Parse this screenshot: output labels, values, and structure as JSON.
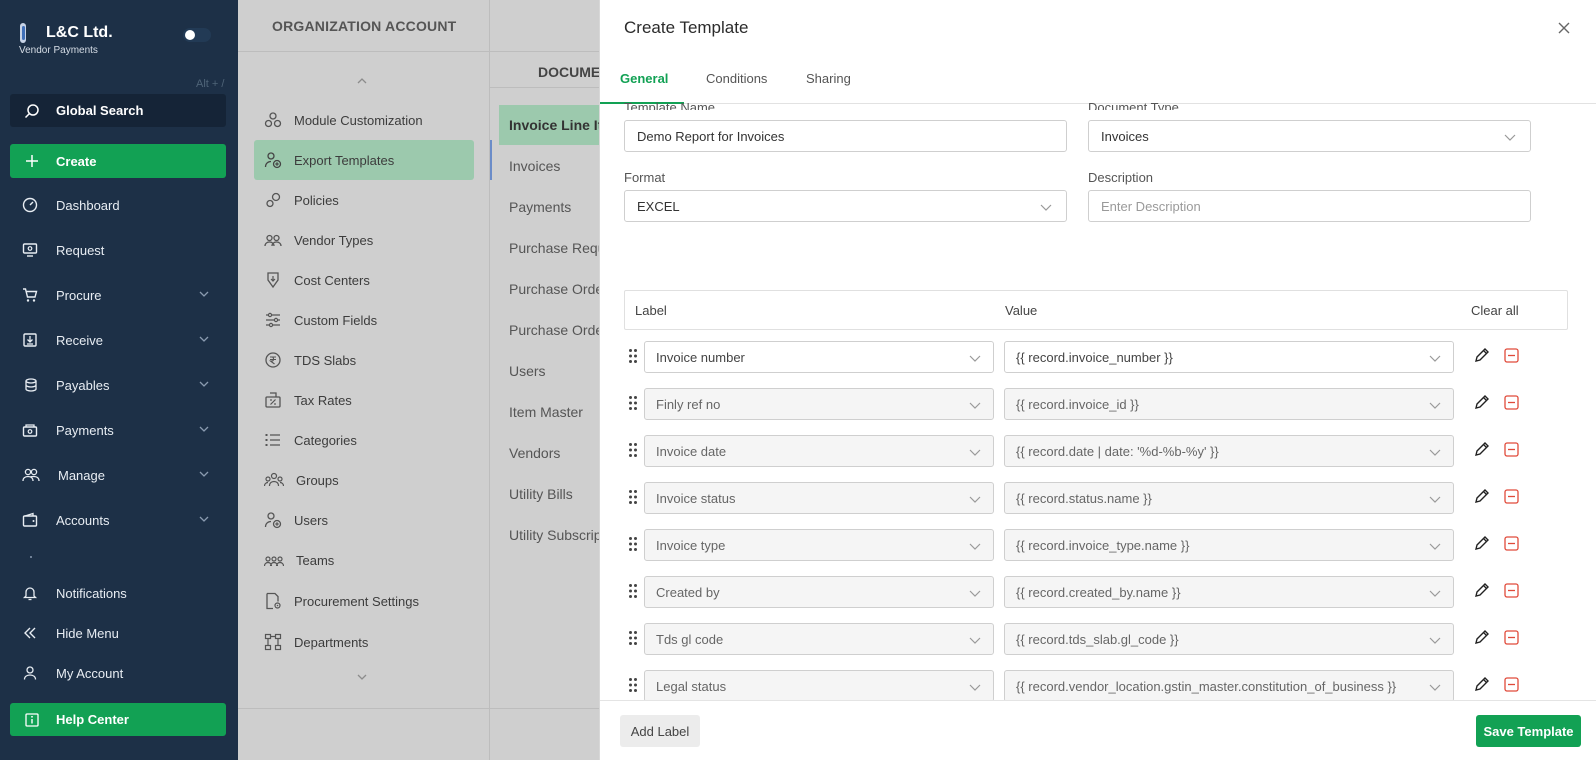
{
  "sidebar": {
    "brand_name": "L&C Ltd.",
    "brand_sub": "Vendor Payments",
    "shortcut_hint": "Alt + /",
    "search_label": "Global Search",
    "create_label": "Create",
    "items": [
      {
        "label": "Dashboard",
        "icon": "dashboard-icon",
        "expandable": false
      },
      {
        "label": "Request",
        "icon": "request-icon",
        "expandable": false
      },
      {
        "label": "Procure",
        "icon": "cart-icon",
        "expandable": true
      },
      {
        "label": "Receive",
        "icon": "receive-icon",
        "expandable": true
      },
      {
        "label": "Payables",
        "icon": "coins-icon",
        "expandable": true
      },
      {
        "label": "Payments",
        "icon": "payments-icon",
        "expandable": true
      },
      {
        "label": "Manage",
        "icon": "people-icon",
        "expandable": true
      },
      {
        "label": "Accounts",
        "icon": "wallet-icon",
        "expandable": true
      }
    ],
    "bottom_items": [
      {
        "label": "Notifications",
        "icon": "bell-icon"
      },
      {
        "label": "Hide Menu",
        "icon": "double-chevron-left-icon"
      },
      {
        "label": "My Account",
        "icon": "user-icon"
      }
    ],
    "help_label": "Help Center"
  },
  "settings": {
    "header": "ORGANIZATION ACCOUNT",
    "items": [
      {
        "label": "Module Customization",
        "icon": "modules-icon",
        "active": false
      },
      {
        "label": "Export Templates",
        "icon": "user-export-icon",
        "active": true
      },
      {
        "label": "Policies",
        "icon": "gears-icon",
        "active": false
      },
      {
        "label": "Vendor Types",
        "icon": "vendors-icon",
        "active": false
      },
      {
        "label": "Cost Centers",
        "icon": "cost-center-icon",
        "active": false
      },
      {
        "label": "Custom Fields",
        "icon": "sliders-icon",
        "active": false
      },
      {
        "label": "TDS Slabs",
        "icon": "tds-icon",
        "active": false
      },
      {
        "label": "Tax Rates",
        "icon": "tax-icon",
        "active": false
      },
      {
        "label": "Categories",
        "icon": "list-icon",
        "active": false
      },
      {
        "label": "Groups",
        "icon": "groups-icon",
        "active": false
      },
      {
        "label": "Users",
        "icon": "users-icon",
        "active": false
      },
      {
        "label": "Teams",
        "icon": "teams-icon",
        "active": false
      },
      {
        "label": "Procurement Settings",
        "icon": "procurement-settings-icon",
        "active": false
      },
      {
        "label": "Departments",
        "icon": "departments-icon",
        "active": false
      }
    ]
  },
  "documents": {
    "title": "DOCUMENTS",
    "items": [
      {
        "label": "Invoice Line Items",
        "active": true
      },
      {
        "label": "Invoices",
        "active": false
      },
      {
        "label": "Payments",
        "active": false
      },
      {
        "label": "Purchase Requests",
        "active": false
      },
      {
        "label": "Purchase Orders",
        "active": false
      },
      {
        "label": "Purchase Orders",
        "active": false
      },
      {
        "label": "Users",
        "active": false
      },
      {
        "label": "Item Master",
        "active": false
      },
      {
        "label": "Vendors",
        "active": false
      },
      {
        "label": "Utility Bills",
        "active": false
      },
      {
        "label": "Utility Subscriptions",
        "active": false
      }
    ]
  },
  "modal": {
    "title": "Create Template",
    "tabs": [
      {
        "label": "General",
        "active": true
      },
      {
        "label": "Conditions",
        "active": false
      },
      {
        "label": "Sharing",
        "active": false
      }
    ],
    "form": {
      "template_name_label": "Template Name",
      "template_name_value": "Demo Report for Invoices",
      "document_type_label": "Document Type",
      "document_type_value": "Invoices",
      "format_label": "Format",
      "format_value": "EXCEL",
      "description_label": "Description",
      "description_placeholder": "Enter Description"
    },
    "table": {
      "label_header": "Label",
      "value_header": "Value",
      "clear_all": "Clear all",
      "rows": [
        {
          "label": "Invoice number",
          "value": "{{ record.invoice_number }}"
        },
        {
          "label": "Finly ref no",
          "value": "{{ record.invoice_id }}"
        },
        {
          "label": "Invoice date",
          "value": "{{ record.date | date: '%d-%b-%y' }}"
        },
        {
          "label": "Invoice status",
          "value": "{{ record.status.name }}"
        },
        {
          "label": "Invoice type",
          "value": "{{ record.invoice_type.name }}"
        },
        {
          "label": "Created by",
          "value": "{{ record.created_by.name }}"
        },
        {
          "label": "Tds gl code",
          "value": "{{ record.tds_slab.gl_code }}"
        },
        {
          "label": "Legal status",
          "value": "{{ record.vendor_location.gstin_master.constitution_of_business }}"
        }
      ]
    },
    "add_label": "Add Label",
    "save_label": "Save Template"
  },
  "colors": {
    "sidebar_bg": "#1d3047",
    "accent_green": "#12a154",
    "danger": "#e04a3a",
    "active_menu_bg": "#9cc9ad"
  }
}
